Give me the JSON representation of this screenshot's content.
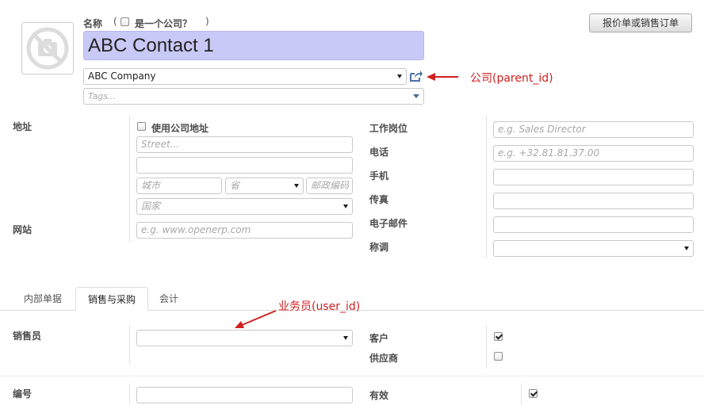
{
  "header": {
    "name_label": "名称",
    "is_company_open": "(",
    "is_company_label": "是一个公司？",
    "is_company_close": ")",
    "name_value": "ABC Contact 1",
    "company_value": "ABC Company",
    "tags_placeholder": "Tags...",
    "quote_button": "报价单或销售订单"
  },
  "annotations": {
    "parent_id": "公司(parent_id)",
    "user_id": "业务员(user_id)"
  },
  "address": {
    "label": "地址",
    "use_company_address": "使用公司地址",
    "street_placeholder": "Street...",
    "city_placeholder": "城市",
    "state_placeholder": "省",
    "zip_placeholder": "邮政编码",
    "country_placeholder": "国家"
  },
  "website": {
    "label": "网站",
    "placeholder": "e.g. www.openerp.com"
  },
  "contact": {
    "job_label": "工作岗位",
    "job_placeholder": "e.g. Sales Director",
    "phone_label": "电话",
    "phone_placeholder": "e.g. +32.81.81.37.00",
    "mobile_label": "手机",
    "fax_label": "传真",
    "email_label": "电子邮件",
    "title_label": "称调"
  },
  "tabs": [
    {
      "label": "内部单据",
      "active": false
    },
    {
      "label": "销售与采购",
      "active": true
    },
    {
      "label": "会计",
      "active": false
    }
  ],
  "sales": {
    "salesperson_label": "销售员",
    "customer_label": "客户",
    "customer_checked": true,
    "supplier_label": "供应商",
    "supplier_checked": false,
    "ref_label": "编号",
    "active_label": "有效",
    "active_checked": true
  },
  "colors": {
    "name_field_bg": "#c9c9f7",
    "annotation_red": "#d21f1f"
  }
}
